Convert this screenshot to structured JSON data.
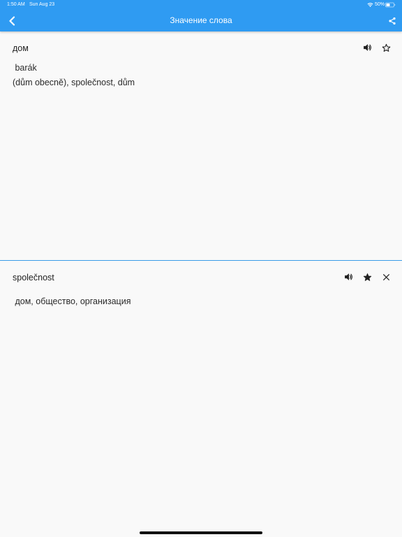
{
  "status_bar": {
    "time": "1:50 AM",
    "date": "Sun Aug 23",
    "battery": "50%"
  },
  "nav": {
    "title": "Значение слова"
  },
  "entries": [
    {
      "word": "дом",
      "translation_lines": [
        " barák",
        "(dům obecně), společnost, dům"
      ],
      "favorite": false,
      "closable": false
    },
    {
      "word": "společnost",
      "translation_lines": [
        " дом, общество, организация"
      ],
      "favorite": true,
      "closable": true
    }
  ],
  "colors": {
    "accent": "#2f9bf2",
    "divider": "#3a9ce8",
    "background": "#f9f9f9"
  }
}
